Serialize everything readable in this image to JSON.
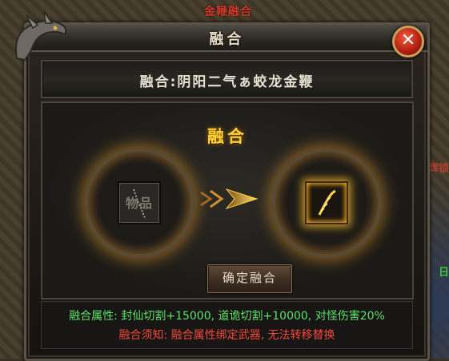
{
  "background": {
    "top_text": "金鞭融合",
    "side_text_1": "辉锁",
    "side_text_2": "日"
  },
  "dialog": {
    "title": "融合",
    "close_symbol": "✕",
    "item_name": "融合:阴阳二气ぁ蛟龙金鞭",
    "panel_title": "融合",
    "left_slot_label": "物品",
    "confirm_label": "确定融合",
    "attr_label": "融合属性:",
    "attr_value": "封仙切割+15000, 道诡切割+10000, 对怪伤害20%",
    "note_label": "融合须知:",
    "note_value": "融合属性绑定武器, 无法转移替换"
  },
  "colors": {
    "accent_gold": "#ffd23a",
    "attr_green": "#5ee06a",
    "note_red": "#f04a3a"
  }
}
